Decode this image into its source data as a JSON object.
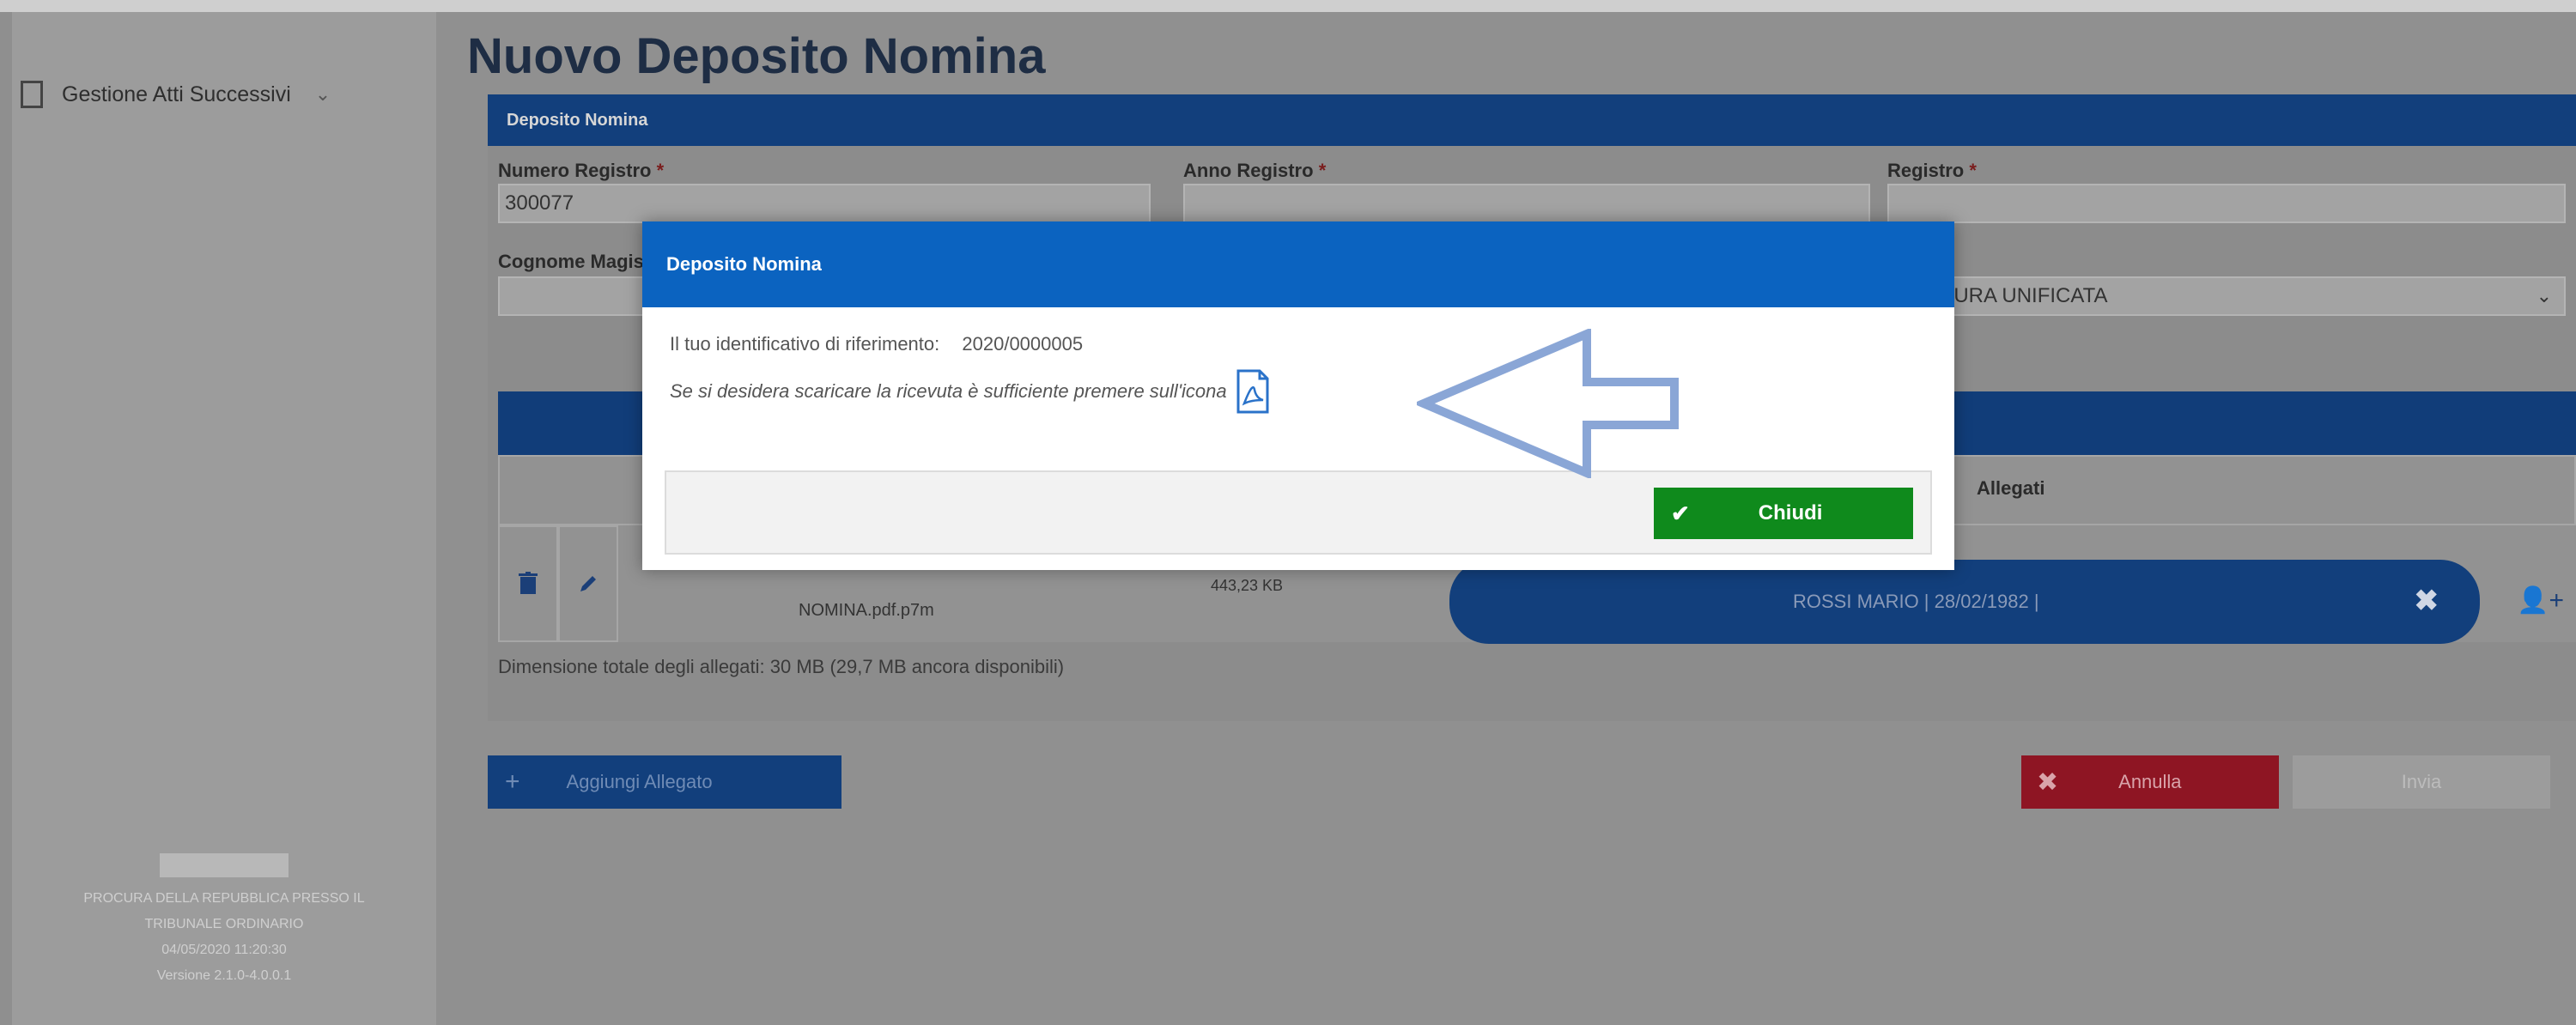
{
  "sidebar": {
    "menu_label": "Gestione Atti Successivi",
    "chevron": "⌄",
    "footer_lines": [
      "PROCURA DELLA REPUBBLICA PRESSO IL",
      "TRIBUNALE ORDINARIO",
      "04/05/2020 11:20:30",
      "Versione 2.1.0-4.0.0.1"
    ]
  },
  "page": {
    "title": "Nuovo Deposito Nomina"
  },
  "section": {
    "header": "Deposito Nomina",
    "fields": {
      "numero_registro": {
        "label": "Numero Registro",
        "value": "300077"
      },
      "anno_registro": {
        "label": "Anno Registro",
        "value": ""
      },
      "registro": {
        "label": "Registro",
        "value": ""
      },
      "cognome_magistrato": {
        "label": "Cognome Magistrato",
        "value": ""
      },
      "ufficio": {
        "label": "",
        "value": "PROCURA UNIFICATA"
      }
    },
    "required_mark": "*",
    "table": {
      "columns": {
        "allegati": "Allegati"
      },
      "row": {
        "delete_icon": "trash-icon",
        "edit_icon": "pencil-icon",
        "filename": "NOMINA.pdf.p7m",
        "filesize": "443,23 KB",
        "party": "ROSSI MARIO | 28/02/1982 |",
        "remove_glyph": "✖",
        "add_party_glyph": "👤+"
      }
    },
    "footnote": "Dimensione totale degli allegati: 30 MB (29,7 MB ancora disponibili)"
  },
  "actions": {
    "add_label": "Aggiungi Allegato",
    "add_glyph": "+",
    "cancel_label": "Annulla",
    "cancel_glyph": "✖",
    "send_label": "Invia"
  },
  "modal": {
    "title": "Deposito Nomina",
    "ref_label": "Il tuo identificativo di riferimento:",
    "ref_value": "2020/0000005",
    "download_text": "Se si desidera scaricare la ricevuta è sufficiente premere sull'icona",
    "pdf_icon": "pdf-file-icon",
    "close_label": "Chiudi",
    "close_glyph": "✔"
  },
  "colors": {
    "modal_header": "#0b63c0",
    "close_button": "#0f8a1c",
    "arrow_stroke": "#8aa6d6"
  }
}
